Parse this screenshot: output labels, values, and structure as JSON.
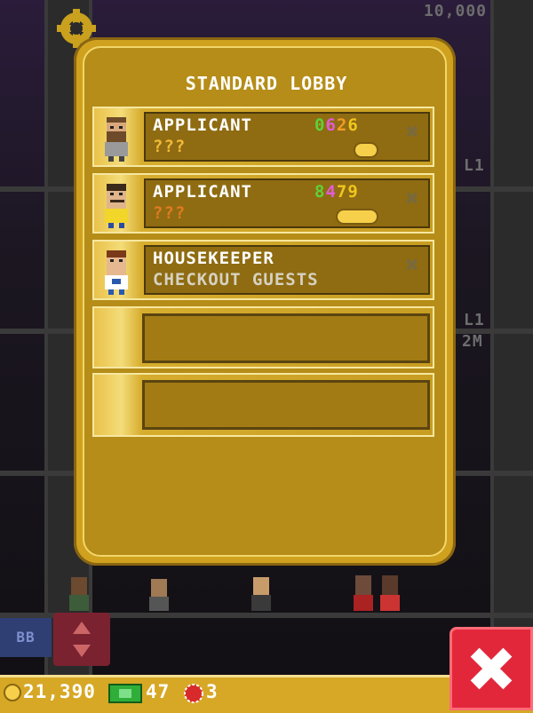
{
  "panel": {
    "title": "STANDARD LOBBY",
    "slots": [
      {
        "line1": "APPLICANT",
        "line2": "???",
        "line2_color": "#f2b93a",
        "codes": [
          "0",
          "6",
          "2",
          "6"
        ],
        "code_colors": [
          "#5fd13a",
          "#e15cd8",
          "#f39a24",
          "#f0c61e"
        ],
        "has_remove": true
      },
      {
        "line1": "APPLICANT",
        "line2": "???",
        "line2_color": "#e07a1f",
        "codes": [
          "8",
          "4",
          "7",
          "9"
        ],
        "code_colors": [
          "#5fd13a",
          "#e15cd8",
          "#f0c61e",
          "#f0c61e"
        ],
        "has_remove": true
      },
      {
        "line1": "HOUSEKEEPER",
        "line2": "CHECKOUT GUESTS",
        "line2_color": "#d7d2c1",
        "codes": [],
        "code_colors": [],
        "has_remove": true
      }
    ],
    "empty_slot_count": 2
  },
  "background": {
    "top_counter": "10,000",
    "floor_labels": [
      "L1",
      "L1",
      "2M"
    ],
    "bb_label": "BB"
  },
  "bottom_bar": {
    "coins": "21,390",
    "bux": "47",
    "tickets": "3"
  },
  "colors": {
    "panel_gold": "#cfa11e",
    "close_red": "#e3273b",
    "coin_yellow": "#f6d04a",
    "bux_green": "#2fae3a"
  },
  "icons": {
    "remove": "close-x-icon",
    "coin": "coin-icon",
    "bux": "bux-bill-icon",
    "ticket": "ticket-icon",
    "close": "close-icon"
  }
}
